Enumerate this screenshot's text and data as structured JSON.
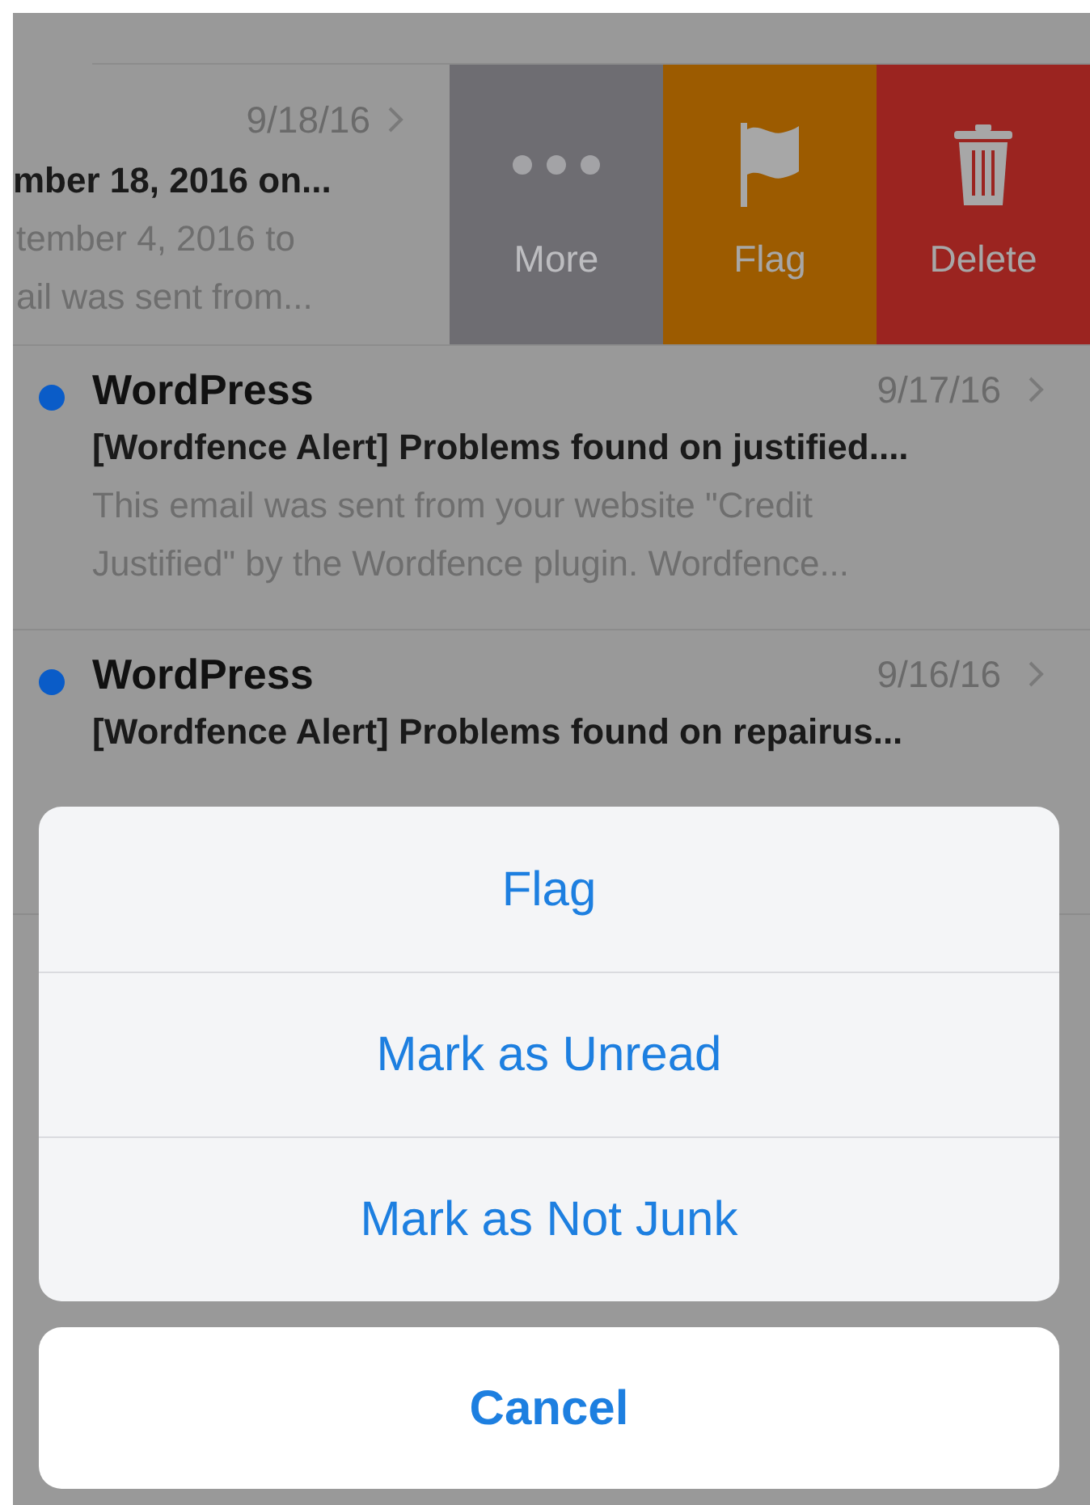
{
  "swiped_message": {
    "date": "9/18/16",
    "subject": "mber 18, 2016 on...",
    "preview_lines": [
      "tember 4, 2016 to",
      "ail was sent from..."
    ],
    "actions": [
      {
        "kind": "more",
        "label": "More"
      },
      {
        "kind": "flag",
        "label": "Flag"
      },
      {
        "kind": "delete",
        "label": "Delete"
      }
    ]
  },
  "messages": [
    {
      "sender": "WordPress",
      "unread": true,
      "date": "9/17/16",
      "subject": "[Wordfence Alert] Problems found on justified....",
      "preview_lines": [
        "This email was sent from your website \"Credit",
        "Justified\" by the Wordfence plugin. Wordfence..."
      ]
    },
    {
      "sender": "WordPress",
      "unread": true,
      "date": "9/16/16",
      "subject": "[Wordfence Alert] Problems found on repairus..."
    }
  ],
  "action_sheet": {
    "items": [
      "Flag",
      "Mark as Unread",
      "Mark as Not Junk"
    ],
    "cancel": "Cancel"
  }
}
